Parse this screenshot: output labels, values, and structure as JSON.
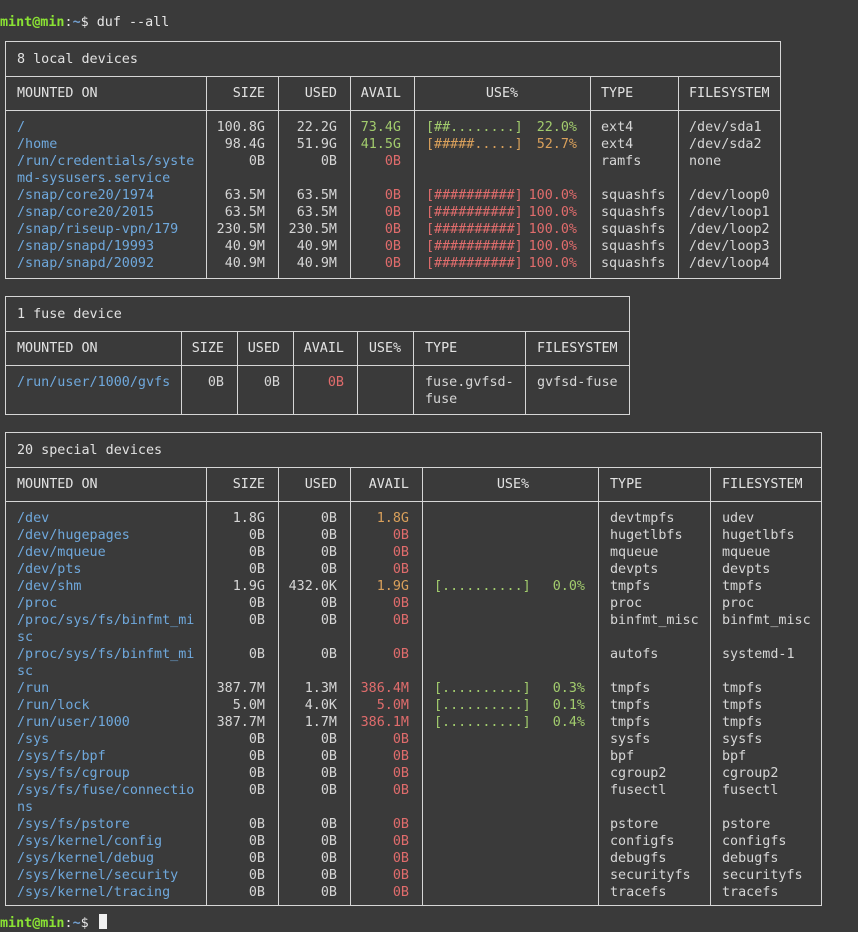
{
  "prompt": {
    "user": "mint@min",
    "sep": ":",
    "path": "~",
    "dollar": "$ ",
    "command": "duf --all"
  },
  "local": {
    "title": "8 local devices",
    "headers": [
      "MOUNTED ON",
      "SIZE",
      "USED",
      "AVAIL",
      "USE%",
      "TYPE",
      "FILESYSTEM"
    ],
    "rows": [
      {
        "mount": [
          "/"
        ],
        "size": "100.8G",
        "used": "22.2G",
        "avail": "73.4G",
        "avail_color": "green",
        "bar": "[##........]",
        "pct": "22.0%",
        "bar_color": "green",
        "type": "ext4",
        "fs": "/dev/sda1"
      },
      {
        "mount": [
          "/home"
        ],
        "size": "98.4G",
        "used": "51.9G",
        "avail": "41.5G",
        "avail_color": "green",
        "bar": "[#####.....]",
        "pct": "52.7%",
        "bar_color": "yellow",
        "type": "ext4",
        "fs": "/dev/sda2"
      },
      {
        "mount": [
          "/run/credentials/syste",
          "md-sysusers.service"
        ],
        "size": "0B",
        "used": "0B",
        "avail": "0B",
        "avail_color": "red",
        "bar": "",
        "pct": "",
        "bar_color": "",
        "type": "ramfs",
        "fs": "none"
      },
      {
        "mount": [
          "/snap/core20/1974"
        ],
        "size": "63.5M",
        "used": "63.5M",
        "avail": "0B",
        "avail_color": "red",
        "bar": "[##########]",
        "pct": "100.0%",
        "bar_color": "red",
        "type": "squashfs",
        "fs": "/dev/loop0"
      },
      {
        "mount": [
          "/snap/core20/2015"
        ],
        "size": "63.5M",
        "used": "63.5M",
        "avail": "0B",
        "avail_color": "red",
        "bar": "[##########]",
        "pct": "100.0%",
        "bar_color": "red",
        "type": "squashfs",
        "fs": "/dev/loop1"
      },
      {
        "mount": [
          "/snap/riseup-vpn/179"
        ],
        "size": "230.5M",
        "used": "230.5M",
        "avail": "0B",
        "avail_color": "red",
        "bar": "[##########]",
        "pct": "100.0%",
        "bar_color": "red",
        "type": "squashfs",
        "fs": "/dev/loop2"
      },
      {
        "mount": [
          "/snap/snapd/19993"
        ],
        "size": "40.9M",
        "used": "40.9M",
        "avail": "0B",
        "avail_color": "red",
        "bar": "[##########]",
        "pct": "100.0%",
        "bar_color": "red",
        "type": "squashfs",
        "fs": "/dev/loop3"
      },
      {
        "mount": [
          "/snap/snapd/20092"
        ],
        "size": "40.9M",
        "used": "40.9M",
        "avail": "0B",
        "avail_color": "red",
        "bar": "[##########]",
        "pct": "100.0%",
        "bar_color": "red",
        "type": "squashfs",
        "fs": "/dev/loop4"
      }
    ]
  },
  "fuse": {
    "title": "1 fuse device",
    "headers": [
      "MOUNTED ON",
      "SIZE",
      "USED",
      "AVAIL",
      "USE%",
      "TYPE",
      "FILESYSTEM"
    ],
    "rows": [
      {
        "mount": [
          "/run/user/1000/gvfs"
        ],
        "size": "0B",
        "used": "0B",
        "avail": "0B",
        "avail_color": "red",
        "bar": "",
        "pct": "",
        "bar_color": "",
        "type": [
          "fuse.gvfsd-",
          "fuse"
        ],
        "fs": "gvfsd-fuse"
      }
    ]
  },
  "special": {
    "title": "20 special devices",
    "headers": [
      "MOUNTED ON",
      "SIZE",
      "USED",
      "AVAIL",
      "USE%",
      "TYPE",
      "FILESYSTEM"
    ],
    "rows": [
      {
        "mount": [
          "/dev"
        ],
        "size": "1.8G",
        "used": "0B",
        "avail": "1.8G",
        "avail_color": "yellow",
        "bar": "",
        "pct": "",
        "bar_color": "",
        "type": "devtmpfs",
        "fs": "udev"
      },
      {
        "mount": [
          "/dev/hugepages"
        ],
        "size": "0B",
        "used": "0B",
        "avail": "0B",
        "avail_color": "red",
        "bar": "",
        "pct": "",
        "bar_color": "",
        "type": "hugetlbfs",
        "fs": "hugetlbfs"
      },
      {
        "mount": [
          "/dev/mqueue"
        ],
        "size": "0B",
        "used": "0B",
        "avail": "0B",
        "avail_color": "red",
        "bar": "",
        "pct": "",
        "bar_color": "",
        "type": "mqueue",
        "fs": "mqueue"
      },
      {
        "mount": [
          "/dev/pts"
        ],
        "size": "0B",
        "used": "0B",
        "avail": "0B",
        "avail_color": "red",
        "bar": "",
        "pct": "",
        "bar_color": "",
        "type": "devpts",
        "fs": "devpts"
      },
      {
        "mount": [
          "/dev/shm"
        ],
        "size": "1.9G",
        "used": "432.0K",
        "avail": "1.9G",
        "avail_color": "yellow",
        "bar": "[..........]",
        "pct": "0.0%",
        "bar_color": "green",
        "type": "tmpfs",
        "fs": "tmpfs"
      },
      {
        "mount": [
          "/proc"
        ],
        "size": "0B",
        "used": "0B",
        "avail": "0B",
        "avail_color": "red",
        "bar": "",
        "pct": "",
        "bar_color": "",
        "type": "proc",
        "fs": "proc"
      },
      {
        "mount": [
          "/proc/sys/fs/binfmt_mi",
          "sc"
        ],
        "size": "0B",
        "used": "0B",
        "avail": "0B",
        "avail_color": "red",
        "bar": "",
        "pct": "",
        "bar_color": "",
        "type": "binfmt_misc",
        "fs": "binfmt_misc"
      },
      {
        "mount": [
          "/proc/sys/fs/binfmt_mi",
          "sc"
        ],
        "size": "0B",
        "used": "0B",
        "avail": "0B",
        "avail_color": "red",
        "bar": "",
        "pct": "",
        "bar_color": "",
        "type": "autofs",
        "fs": "systemd-1"
      },
      {
        "mount": [
          "/run"
        ],
        "size": "387.7M",
        "used": "1.3M",
        "avail": "386.4M",
        "avail_color": "red",
        "bar": "[..........]",
        "pct": "0.3%",
        "bar_color": "green",
        "type": "tmpfs",
        "fs": "tmpfs"
      },
      {
        "mount": [
          "/run/lock"
        ],
        "size": "5.0M",
        "used": "4.0K",
        "avail": "5.0M",
        "avail_color": "red",
        "bar": "[..........]",
        "pct": "0.1%",
        "bar_color": "green",
        "type": "tmpfs",
        "fs": "tmpfs"
      },
      {
        "mount": [
          "/run/user/1000"
        ],
        "size": "387.7M",
        "used": "1.7M",
        "avail": "386.1M",
        "avail_color": "red",
        "bar": "[..........]",
        "pct": "0.4%",
        "bar_color": "green",
        "type": "tmpfs",
        "fs": "tmpfs"
      },
      {
        "mount": [
          "/sys"
        ],
        "size": "0B",
        "used": "0B",
        "avail": "0B",
        "avail_color": "red",
        "bar": "",
        "pct": "",
        "bar_color": "",
        "type": "sysfs",
        "fs": "sysfs"
      },
      {
        "mount": [
          "/sys/fs/bpf"
        ],
        "size": "0B",
        "used": "0B",
        "avail": "0B",
        "avail_color": "red",
        "bar": "",
        "pct": "",
        "bar_color": "",
        "type": "bpf",
        "fs": "bpf"
      },
      {
        "mount": [
          "/sys/fs/cgroup"
        ],
        "size": "0B",
        "used": "0B",
        "avail": "0B",
        "avail_color": "red",
        "bar": "",
        "pct": "",
        "bar_color": "",
        "type": "cgroup2",
        "fs": "cgroup2"
      },
      {
        "mount": [
          "/sys/fs/fuse/connectio",
          "ns"
        ],
        "size": "0B",
        "used": "0B",
        "avail": "0B",
        "avail_color": "red",
        "bar": "",
        "pct": "",
        "bar_color": "",
        "type": "fusectl",
        "fs": "fusectl"
      },
      {
        "mount": [
          "/sys/fs/pstore"
        ],
        "size": "0B",
        "used": "0B",
        "avail": "0B",
        "avail_color": "red",
        "bar": "",
        "pct": "",
        "bar_color": "",
        "type": "pstore",
        "fs": "pstore"
      },
      {
        "mount": [
          "/sys/kernel/config"
        ],
        "size": "0B",
        "used": "0B",
        "avail": "0B",
        "avail_color": "red",
        "bar": "",
        "pct": "",
        "bar_color": "",
        "type": "configfs",
        "fs": "configfs"
      },
      {
        "mount": [
          "/sys/kernel/debug"
        ],
        "size": "0B",
        "used": "0B",
        "avail": "0B",
        "avail_color": "red",
        "bar": "",
        "pct": "",
        "bar_color": "",
        "type": "debugfs",
        "fs": "debugfs"
      },
      {
        "mount": [
          "/sys/kernel/security"
        ],
        "size": "0B",
        "used": "0B",
        "avail": "0B",
        "avail_color": "red",
        "bar": "",
        "pct": "",
        "bar_color": "",
        "type": "securityfs",
        "fs": "securityfs"
      },
      {
        "mount": [
          "/sys/kernel/tracing"
        ],
        "size": "0B",
        "used": "0B",
        "avail": "0B",
        "avail_color": "red",
        "bar": "",
        "pct": "",
        "bar_color": "",
        "type": "tracefs",
        "fs": "tracefs"
      }
    ]
  },
  "colors": {
    "background": "#3a3a3a",
    "mount": "#6fa8dc",
    "green": "#a2cc6d",
    "yellow": "#d9a05b",
    "red": "#e06c6c"
  }
}
